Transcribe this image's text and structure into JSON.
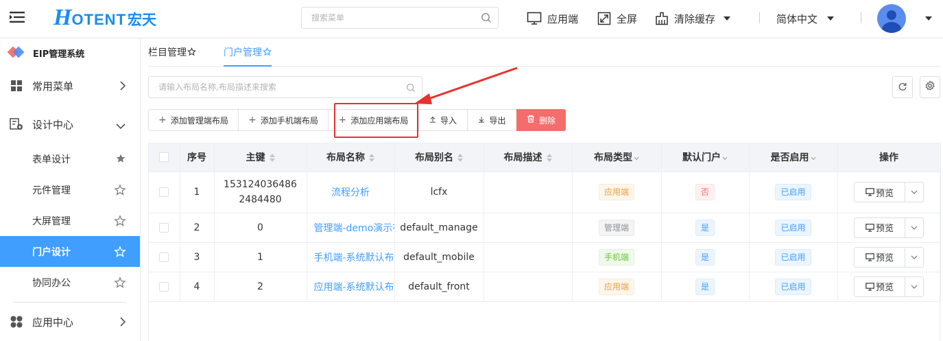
{
  "header": {
    "logo_h": "H",
    "logo_text": "OTENT",
    "logo_cn": "宏天",
    "search_placeholder": "搜索菜单",
    "app_end": "应用端",
    "fullscreen": "全屏",
    "clear_cache": "清除缓存",
    "language": "简体中文"
  },
  "sidebar": {
    "system_title": "EIP管理系统",
    "groups": [
      {
        "label": "常用菜单",
        "icon": "grid-icon"
      },
      {
        "label": "设计中心",
        "icon": "design-icon"
      },
      {
        "label": "应用中心",
        "icon": "apps-icon"
      }
    ],
    "items": [
      {
        "label": "表单设计",
        "starred": true
      },
      {
        "label": "元件管理",
        "starred": false
      },
      {
        "label": "大屏管理",
        "starred": false
      },
      {
        "label": "门户设计",
        "starred": false,
        "active": true
      },
      {
        "label": "协同办公",
        "starred": false
      }
    ]
  },
  "tabs": [
    {
      "label": "栏目管理"
    },
    {
      "label": "门户管理",
      "active": true
    }
  ],
  "filter": {
    "placeholder": "请输入布局名称,布局描述来搜索"
  },
  "toolbar": {
    "add_manage": "添加管理端布局",
    "add_mobile": "添加手机端布局",
    "add_front": "添加应用端布局",
    "import": "导入",
    "export": "导出",
    "delete": "删除"
  },
  "table": {
    "headers": {
      "index": "序号",
      "pk": "主键",
      "name": "布局名称",
      "alias": "布局别名",
      "desc": "布局描述",
      "type": "布局类型",
      "default_portal": "默认门户",
      "enabled": "是否启用",
      "ops": "操作"
    },
    "rows": [
      {
        "index": "1",
        "pk": "1531240364862484480",
        "name": "流程分析",
        "alias": "lcfx",
        "desc": "",
        "type": "应用端",
        "default": "否",
        "enabled": "已启用",
        "op": "预览"
      },
      {
        "index": "2",
        "pk": "0",
        "name": "管理端-demo演示布局",
        "alias": "default_manage",
        "desc": "",
        "type": "管理端",
        "default": "是",
        "enabled": "已启用",
        "op": "预览"
      },
      {
        "index": "3",
        "pk": "1",
        "name": "手机端-系统默认布局",
        "alias": "default_mobile",
        "desc": "",
        "type": "手机端",
        "default": "是",
        "enabled": "已启用",
        "op": "预览"
      },
      {
        "index": "4",
        "pk": "2",
        "name": "应用端-系统默认布局",
        "alias": "default_front",
        "desc": "",
        "type": "应用端",
        "default": "是",
        "enabled": "已启用",
        "op": "预览"
      }
    ]
  },
  "colors": {
    "primary": "#409eff",
    "danger": "#f56c6c",
    "annotation_red": "#e8312d",
    "logo_blue": "#1a8cf0"
  }
}
